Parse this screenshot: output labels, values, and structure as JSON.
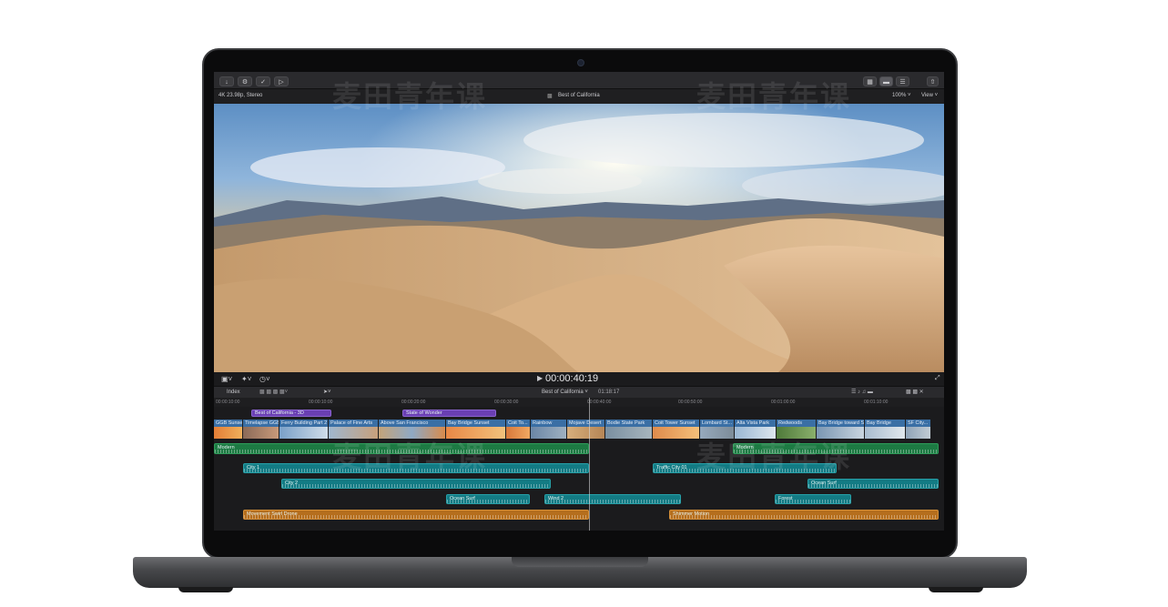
{
  "watermark": "麦田青年课",
  "toolbar": {
    "buttons": [
      "import-icon",
      "key-icon",
      "check-icon",
      "tag-icon"
    ],
    "format_label": "4K 23.98p, Stereo",
    "project_title": "Best of California",
    "zoom_label": "100% ˅",
    "view_label": "View ˅"
  },
  "viewer": {
    "timecode": "00:00:40:19"
  },
  "timeline_header": {
    "index_label": "Index",
    "project_selector": "Best of California ˅",
    "duration": "01:18:17",
    "ruler_ticks": [
      "00:00:10:00",
      "00:00:20:00",
      "00:00:30:00",
      "00:00:40:00",
      "00:00:50:00",
      "00:01:00:00",
      "00:01:10:00"
    ]
  },
  "timeline": {
    "connected_titles": [
      "Best of California - 3D",
      "State of Wonder"
    ],
    "primary_clips": [
      "GGB Sunset",
      "Timelapse GGB",
      "Ferry Building Part 2",
      "Palace of Fine Arts",
      "Above San Francisco",
      "Bay Bridge Sunset",
      "Coit To...",
      "Rainbow",
      "Mojave Desert",
      "Bodie State Park",
      "Coit Tower Sunset",
      "Lombard St...",
      "Alta Vista Park",
      "Redwoods",
      "Bay Bridge toward SF",
      "Bay Bridge",
      "SF City..."
    ],
    "music_tracks": [
      "Modern",
      "Modern"
    ],
    "audio_clips": [
      "City 1",
      "Traffic City 01",
      "City 2",
      "Ocean Surf",
      "Ocean Surf",
      "Wind 2",
      "Forest"
    ],
    "effects_clips": [
      "Movement Swirl Drone",
      "Shimmer Motion"
    ]
  },
  "colors": {
    "aqua": "#137b84",
    "orange": "#b56e1d",
    "green": "#1d7a43",
    "purple": "#6a3fb3",
    "clip_blue": "#3a6fa5"
  }
}
